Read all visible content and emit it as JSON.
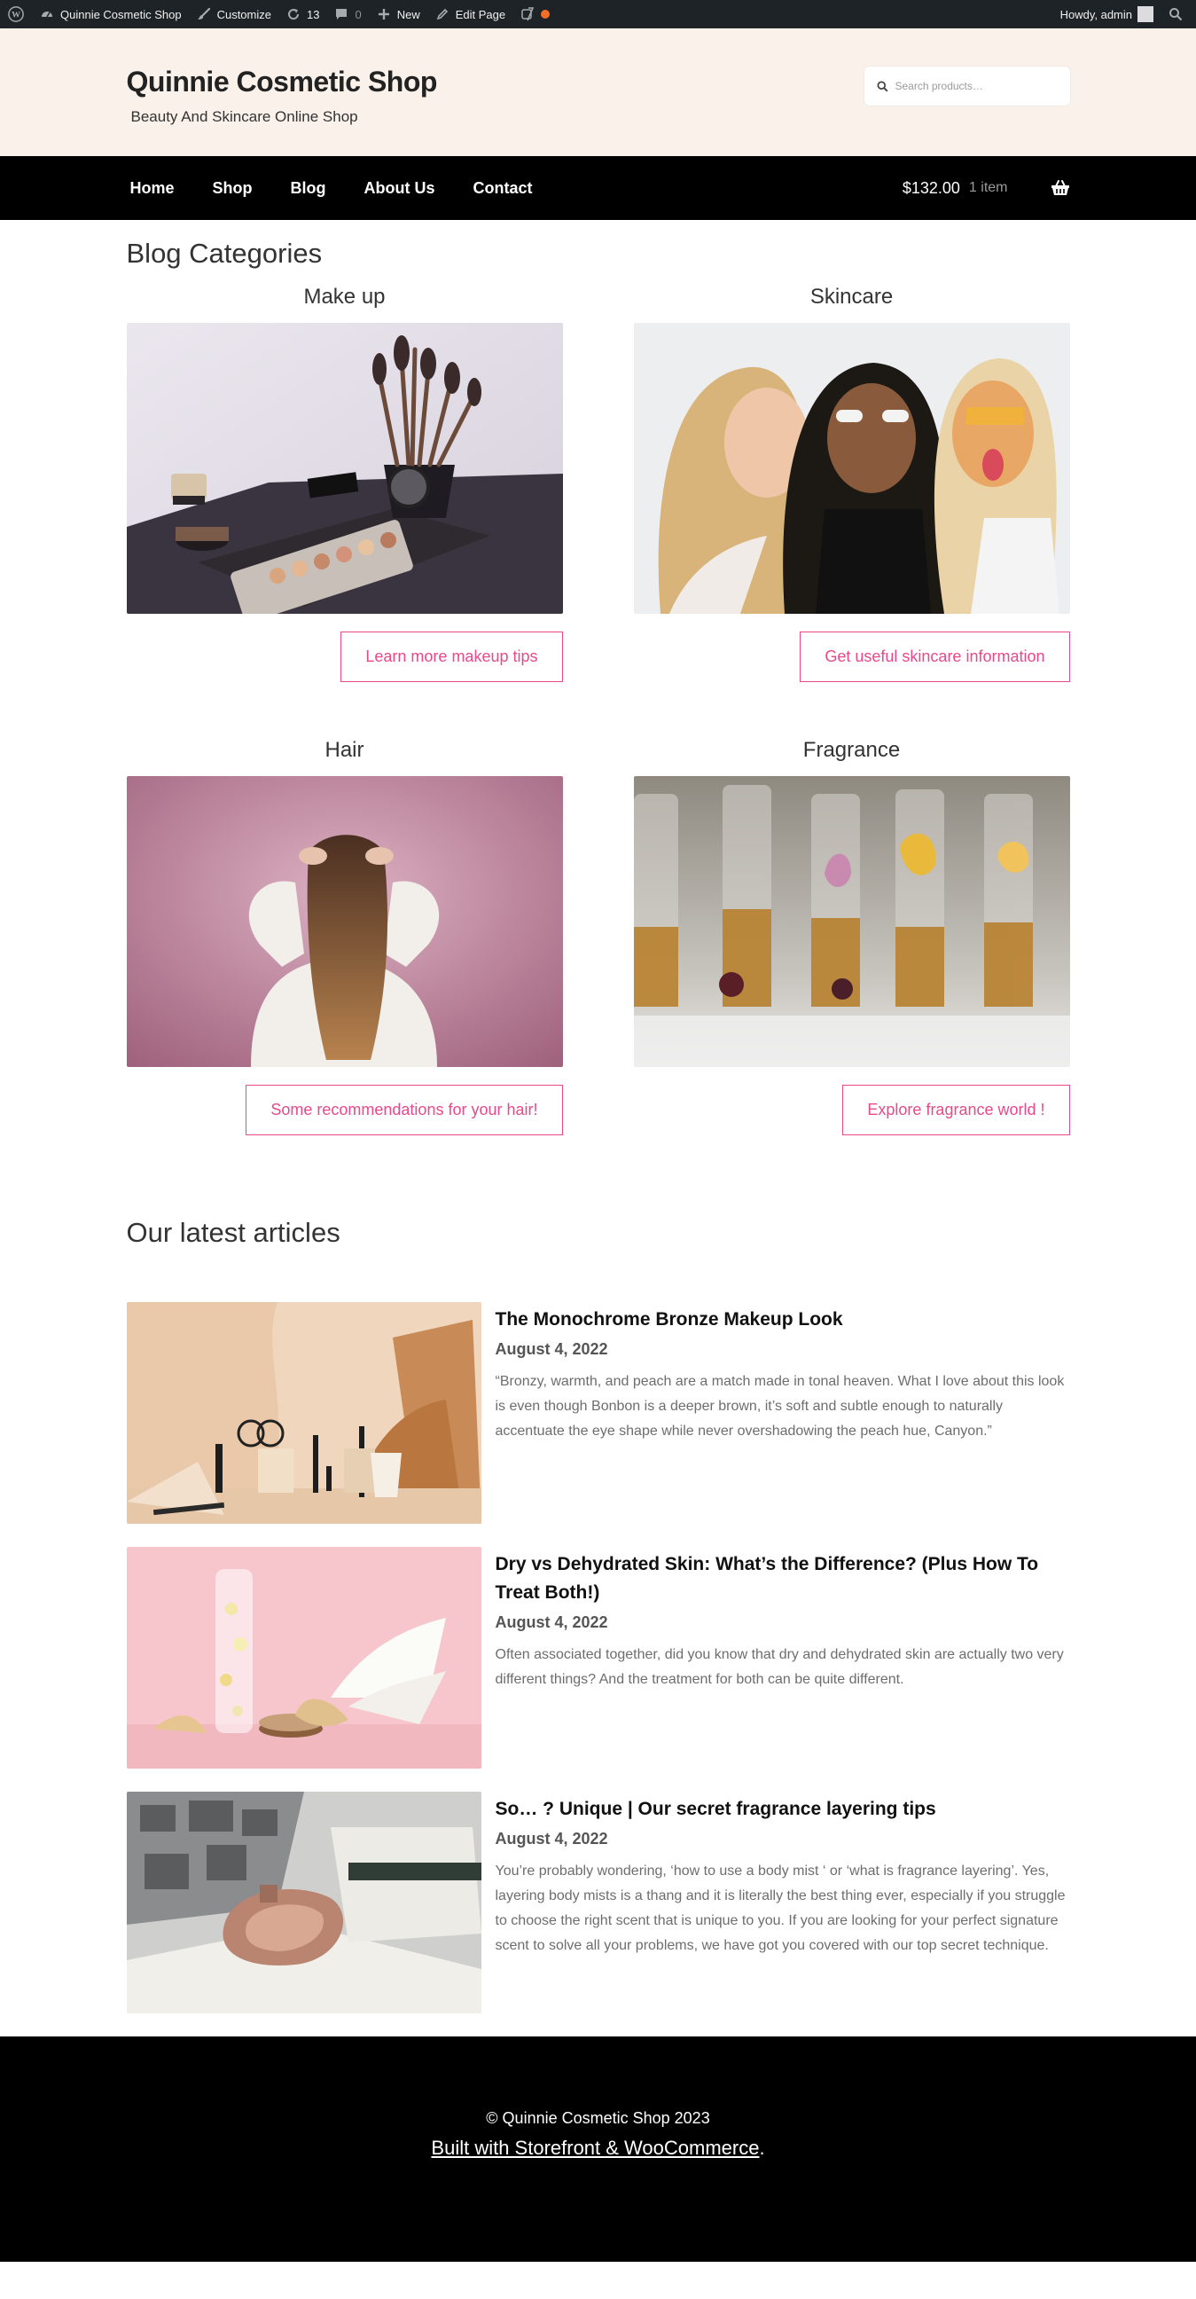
{
  "admin_bar": {
    "site_name": "Quinnie Cosmetic Shop",
    "customize": "Customize",
    "updates_count": "13",
    "comments_count": "0",
    "new": "New",
    "edit_page": "Edit Page",
    "howdy": "Howdy, admin"
  },
  "header": {
    "title": "Quinnie Cosmetic Shop",
    "tagline": "Beauty And Skincare Online Shop",
    "search_placeholder": "Search products…"
  },
  "nav": {
    "items": [
      "Home",
      "Shop",
      "Blog",
      "About Us",
      "Contact"
    ],
    "cart_amount": "$132.00",
    "cart_count": "1 item"
  },
  "blog_categories": {
    "title": "Blog Categories",
    "items": [
      {
        "name": "Make up",
        "button": "Learn more makeup tips"
      },
      {
        "name": "Skincare",
        "button": "Get useful skincare information"
      },
      {
        "name": "Hair",
        "button": "Some recommendations for your hair!"
      },
      {
        "name": "Fragrance",
        "button": "Explore fragrance world !"
      }
    ]
  },
  "latest": {
    "title": "Our latest articles",
    "articles": [
      {
        "title": "The Monochrome Bronze Makeup Look",
        "date": "August 4, 2022",
        "excerpt": "“Bronzy, warmth, and peach are a match made in tonal heaven. What I love about this look is even though Bonbon is a deeper brown, it’s soft and subtle enough to naturally accentuate the eye shape while never overshadowing the peach hue, Canyon.”"
      },
      {
        "title": "Dry vs Dehydrated Skin: What’s the Difference? (Plus How To Treat Both!)",
        "date": "August 4, 2022",
        "excerpt": "Often associated together, did you know that dry and dehydrated skin are actually two very different things? And the treatment for both can be quite different."
      },
      {
        "title": "So… ? Unique | Our secret fragrance layering tips",
        "date": "August 4, 2022",
        "excerpt": "You’re probably wondering, ‘how to use a body mist ‘ or ‘what is fragrance layering’. Yes, layering body mists is a thang and it is literally the best thing ever, especially if you struggle to choose the right scent that is unique to you. If you are looking for your perfect signature scent to solve all your problems, we have got you covered with our top secret technique."
      }
    ]
  },
  "footer": {
    "copyright": "© Quinnie Cosmetic Shop 2023",
    "credit_link": "Built with Storefront & WooCommerce",
    "credit_suffix": "."
  },
  "colors": {
    "accent": "#e8498a",
    "header_bg": "#f9f1ea",
    "nav_bg": "#000000"
  }
}
